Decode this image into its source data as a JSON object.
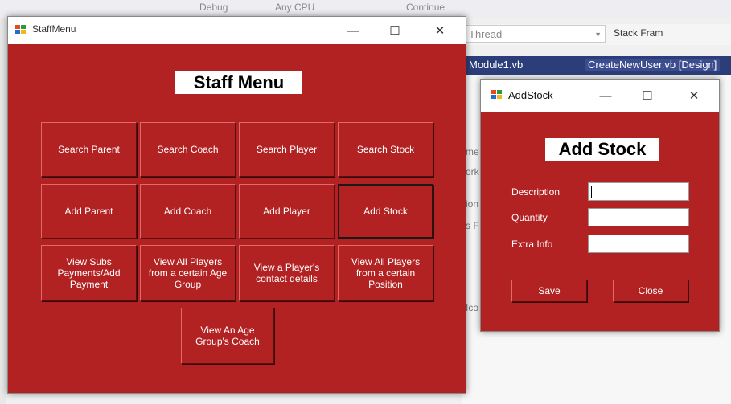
{
  "ide": {
    "toolbar": {
      "debug": "Debug",
      "cpu": "Any CPU",
      "continue": "Continue"
    },
    "thread_label": "Thread",
    "stack_frame": "Stack Fram",
    "tabs": [
      "Module1.vb",
      "CreateNewUser.vb [Design]"
    ],
    "fragments": [
      "me",
      "ork",
      "ion",
      "s F",
      "Ico"
    ]
  },
  "staff_menu": {
    "window_title": "StaffMenu",
    "heading": "Staff Menu",
    "buttons": [
      "Search Parent",
      "Search Coach",
      "Search Player",
      "Search Stock",
      "Add Parent",
      "Add Coach",
      "Add Player",
      "Add Stock",
      "View Subs Payments/Add Payment",
      "View All Players from a certain Age Group",
      "View a Player's contact details",
      "View All Players from a certain Position",
      "View An Age Group's Coach"
    ]
  },
  "add_stock": {
    "window_title": "AddStock",
    "heading": "Add Stock",
    "fields": [
      {
        "label": "Description",
        "value": ""
      },
      {
        "label": "Quantity",
        "value": ""
      },
      {
        "label": "Extra Info",
        "value": ""
      }
    ],
    "save_label": "Save",
    "close_label": "Close"
  },
  "caption_buttons": {
    "minimize": "—",
    "maximize": "☐",
    "close": "✕"
  },
  "colors": {
    "form_background": "#b22222",
    "ide_tab_bar": "#2c3e7a"
  }
}
